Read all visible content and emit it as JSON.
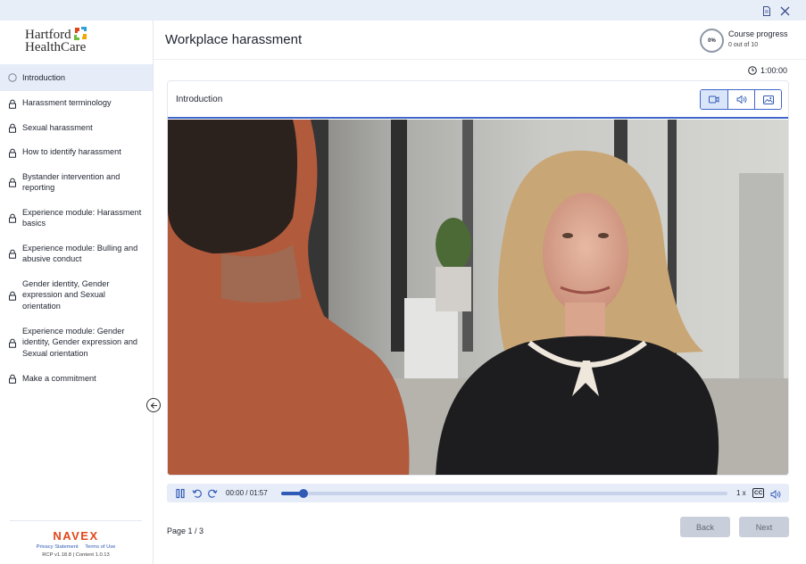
{
  "logo": {
    "line1": "Hartford",
    "line2": "HealthCare"
  },
  "course": {
    "title": "Workplace harassment",
    "progress_label": "Course progress",
    "progress_percent": "0%",
    "progress_count": "0 out of 10",
    "timer": "1:00:00"
  },
  "nav": {
    "items": [
      {
        "label": "Introduction",
        "state": "current"
      },
      {
        "label": "Harassment terminology",
        "state": "locked"
      },
      {
        "label": "Sexual harassment",
        "state": "locked"
      },
      {
        "label": "How to identify harassment",
        "state": "locked"
      },
      {
        "label": "Bystander intervention and reporting",
        "state": "locked"
      },
      {
        "label": "Experience module: Harassment basics",
        "state": "locked"
      },
      {
        "label": "Experience module: Bulling and abusive conduct",
        "state": "locked"
      },
      {
        "label": "Gender identity, Gender expression and Sexual orientation",
        "state": "locked"
      },
      {
        "label": "Experience module: Gender identity, Gender expression and Sexual orientation",
        "state": "locked"
      },
      {
        "label": "Make a commitment",
        "state": "locked"
      }
    ]
  },
  "footer": {
    "brand": "NAVEX",
    "privacy": "Privacy Statement",
    "terms": "Terms of Use",
    "version": "RCP v1.18.8  |  Content 1.0.13"
  },
  "card": {
    "title": "Introduction"
  },
  "player": {
    "time": "00:00 / 01:57",
    "progress_fraction": 0.05,
    "speed": "1 x",
    "cc": "CC"
  },
  "pager": {
    "page": "Page 1 / 3",
    "back": "Back",
    "next": "Next"
  },
  "colors": {
    "accent": "#2f5ab5",
    "active_bg": "#e6ecf8",
    "disabled_btn": "#c9cfda",
    "brand_navex": "#e2461b"
  },
  "icons": {
    "topbar": [
      "document-icon",
      "close-icon"
    ],
    "media_modes": [
      "video-icon",
      "audio-icon",
      "image-icon"
    ]
  }
}
